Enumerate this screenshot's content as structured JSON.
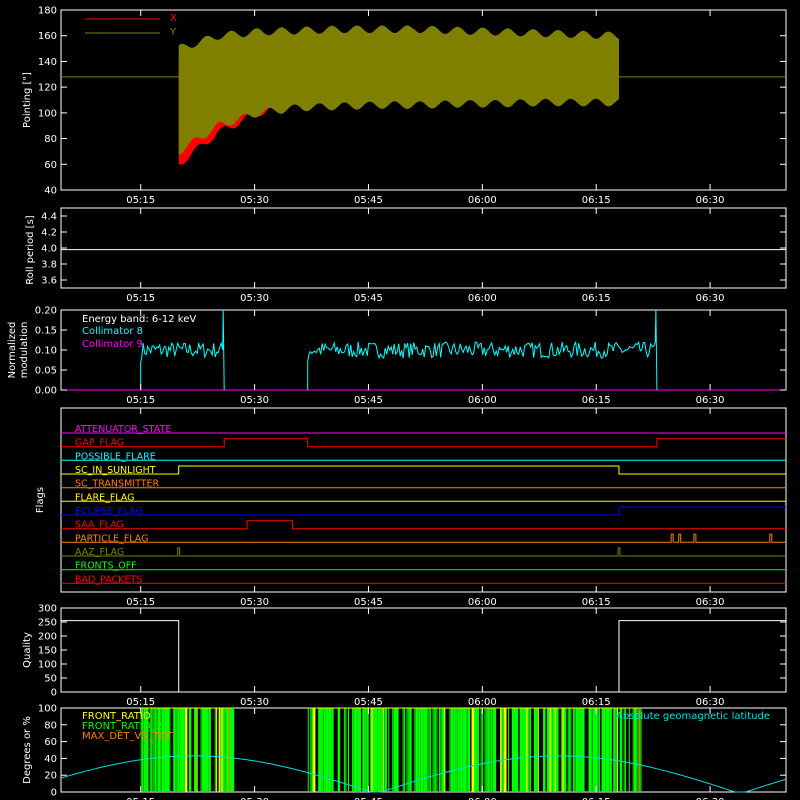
{
  "colors": {
    "background": "#000000",
    "axis": "#ffffff",
    "x_series": "#ff0000",
    "y_series": "#808000",
    "collimator8": "#00ffff",
    "collimator9": "#ff00ff",
    "geomag": "#00e0e0",
    "front_ratio": "#ffff00",
    "front_ratio_2": "#00ff00",
    "max_det_vs_tot": "#ff8000"
  },
  "chart_data": [
    {
      "type": "area",
      "ylabel": "Pointing [\"]",
      "ylim": [
        40,
        180
      ],
      "y_ticks": [
        "40",
        "60",
        "80",
        "100",
        "120",
        "140",
        "160",
        "180"
      ],
      "x_ticks": [
        "05:15",
        "05:30",
        "05:45",
        "06:00",
        "06:15",
        "06:30"
      ],
      "xlim_minutes_of_day": [
        304,
        340
      ],
      "legend": [
        "X",
        "Y"
      ],
      "series": [
        {
          "name": "X",
          "color": "#ff0000",
          "start": "05:20",
          "end": "06:18",
          "baseline": 128,
          "upper_envelope": [
            140,
            150,
            157,
            160,
            160,
            162,
            163,
            160,
            158,
            155,
            152,
            150
          ],
          "lower_envelope": [
            60,
            85,
            100,
            108,
            112,
            115,
            116,
            117,
            118,
            118,
            118,
            117
          ]
        },
        {
          "name": "Y",
          "color": "#808000",
          "start": "05:20",
          "end": "06:18",
          "baseline": 128,
          "upper_envelope": [
            150,
            160,
            163,
            164,
            165,
            165,
            165,
            164,
            163,
            162,
            161,
            160
          ],
          "lower_envelope": [
            70,
            90,
            100,
            104,
            105,
            106,
            106,
            107,
            107,
            108,
            108,
            108
          ]
        }
      ]
    },
    {
      "type": "line",
      "ylabel": "Roll period [s]",
      "ylim": [
        3.5,
        4.5
      ],
      "y_ticks": [
        "3.6",
        "3.8",
        "4.0",
        "4.2",
        "4.4"
      ],
      "x_ticks": [
        "05:15",
        "05:30",
        "05:45",
        "06:00",
        "06:15",
        "06:30"
      ],
      "series": [
        {
          "value": 3.98
        }
      ]
    },
    {
      "type": "line",
      "ylabel": "Normalized modulation",
      "ylim": [
        0,
        0.2
      ],
      "y_ticks": [
        "0.00",
        "0.05",
        "0.10",
        "0.15",
        "0.20"
      ],
      "x_ticks": [
        "05:15",
        "05:30",
        "05:45",
        "06:00",
        "06:15",
        "06:30"
      ],
      "annotation": "Energy band: 6-12 keV",
      "legend": [
        "Collimator 8",
        "Collimator 9"
      ],
      "series": [
        {
          "name": "Collimator 8",
          "segments": [
            [
              "05:15",
              "05:26"
            ],
            [
              "05:37",
              "06:23"
            ]
          ],
          "mean": 0.1,
          "spread": 0.02
        },
        {
          "name": "Collimator 9",
          "value": 0.0
        }
      ]
    },
    {
      "type": "line",
      "ylabel": "Flags",
      "x_ticks": [
        "05:15",
        "05:30",
        "05:45",
        "06:00",
        "06:15",
        "06:30"
      ],
      "flags": [
        {
          "label": "ATTENUATOR_STATE",
          "color": "#ff00ff",
          "transitions": []
        },
        {
          "label": "GAP_FLAG",
          "color": "#ff0000",
          "transitions": [
            [
              "05:26",
              1
            ],
            [
              "05:37",
              0
            ],
            [
              "06:23",
              1
            ]
          ]
        },
        {
          "label": "POSSIBLE_FLARE",
          "color": "#00ffff",
          "transitions": []
        },
        {
          "label": "SC_IN_SUNLIGHT",
          "color": "#ffff00",
          "transitions": [
            [
              "05:20",
              1
            ],
            [
              "06:18",
              0
            ]
          ]
        },
        {
          "label": "SC_TRANSMITTER",
          "color": "#ff8000",
          "transitions": []
        },
        {
          "label": "FLARE_FLAG",
          "color": "#ffff00",
          "transitions": []
        },
        {
          "label": "ECLIPSE_FLAG",
          "color": "#0000ff",
          "transitions": [
            [
              "05:20",
              0
            ],
            [
              "06:18",
              1
            ]
          ]
        },
        {
          "label": "SAA_FLAG",
          "color": "#ff0000",
          "transitions": [
            [
              "05:29",
              1
            ],
            [
              "05:35",
              0
            ]
          ]
        },
        {
          "label": "PARTICLE_FLAG",
          "color": "#ff8000",
          "spikes": [
            "06:25",
            "06:26",
            "06:28",
            "06:38"
          ]
        },
        {
          "label": "AAZ_FLAG",
          "color": "#808000",
          "spikes": [
            "05:20",
            "06:18"
          ]
        },
        {
          "label": "FRONTS_OFF",
          "color": "#00ff00",
          "transitions": []
        },
        {
          "label": "BAD_PACKETS",
          "color": "#ff0000",
          "transitions": []
        }
      ]
    },
    {
      "type": "line",
      "ylabel": "Quality",
      "ylim": [
        0,
        300
      ],
      "y_ticks": [
        "0",
        "50",
        "100",
        "150",
        "200",
        "250",
        "300"
      ],
      "x_ticks": [
        "05:15",
        "05:30",
        "05:45",
        "06:00",
        "06:15",
        "06:30"
      ],
      "series": [
        {
          "segments": [
            [
              "05:10",
              "05:20",
              255
            ],
            [
              "05:20",
              "06:18",
              0
            ],
            [
              "06:18",
              "06:40",
              255
            ]
          ]
        }
      ]
    },
    {
      "type": "line",
      "ylabel": "Degrees or %",
      "ylim": [
        0,
        100
      ],
      "y_ticks": [
        "0",
        "20",
        "40",
        "60",
        "80",
        "100"
      ],
      "x_ticks": [
        "05:15",
        "05:30",
        "05:45",
        "06:00",
        "06:15",
        "06:30"
      ],
      "legend": [
        "FRONT_RATIO",
        "FRONT_RATIO_2",
        "MAX_DET_VS_TOT"
      ],
      "annotation": "Absolute geomagnetic latitude",
      "series": [
        {
          "name": "FRONT_RATIO",
          "segments": [
            [
              "05:15",
              "05:27"
            ],
            [
              "05:37",
              "06:21"
            ]
          ]
        },
        {
          "name": "FRONT_RATIO_2",
          "segments": [
            [
              "05:15",
              "05:27"
            ],
            [
              "05:37",
              "06:21"
            ]
          ]
        },
        {
          "name": "MAX_DET_VS_TOT",
          "segments": [
            [
              "05:15",
              "05:27"
            ],
            [
              "05:37",
              "06:21"
            ]
          ]
        },
        {
          "name": "Absolute geomagnetic latitude",
          "period_minutes": 48,
          "min": 0,
          "max": 45
        }
      ]
    }
  ],
  "panel1": {
    "ylabel": "Pointing [\"]",
    "legend_x": "X",
    "legend_y": "Y"
  },
  "panel2": {
    "ylabel": "Roll period [s]"
  },
  "panel3": {
    "ylabel_1": "Normalized",
    "ylabel_2": "modulation",
    "energy": "Energy band: 6-12 keV",
    "c8": "Collimator 8",
    "c9": "Collimator 9"
  },
  "panel4": {
    "ylabel": "Flags"
  },
  "panel5": {
    "ylabel": "Quality"
  },
  "panel6": {
    "ylabel": "Degrees or %",
    "l1": "FRONT_RATIO",
    "l2": "FRONT_RATIO_2",
    "l3": "MAX_DET_VS_TOT",
    "geomag": "Absolute geomagnetic latitude"
  }
}
